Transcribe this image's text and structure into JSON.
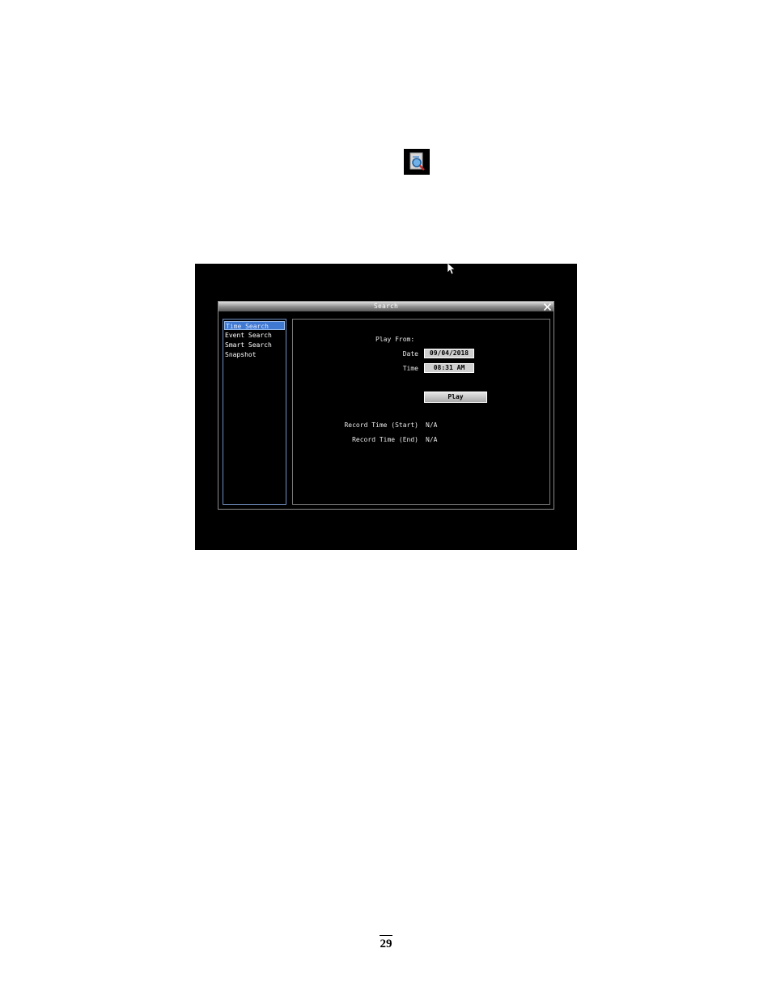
{
  "dialog": {
    "title": "Search"
  },
  "sidebar": {
    "items": [
      {
        "label": "Time Search",
        "active": true
      },
      {
        "label": "Event Search",
        "active": false
      },
      {
        "label": "Smart Search",
        "active": false
      },
      {
        "label": "Snapshot",
        "active": false
      }
    ]
  },
  "form": {
    "play_from_label": "Play From:",
    "date_label": "Date",
    "date_value": "09/04/2018",
    "time_label": "Time",
    "time_value": "08:31 AM",
    "play_label": "Play",
    "record_start_label": "Record Time (Start)",
    "record_start_value": "N/A",
    "record_end_label": "Record Time (End)",
    "record_end_value": "N/A"
  },
  "page": {
    "number": "29"
  },
  "colors": {
    "screen_bg": "#000000",
    "selection": "#3f79d2",
    "field_bg": "#cfcfcf"
  }
}
